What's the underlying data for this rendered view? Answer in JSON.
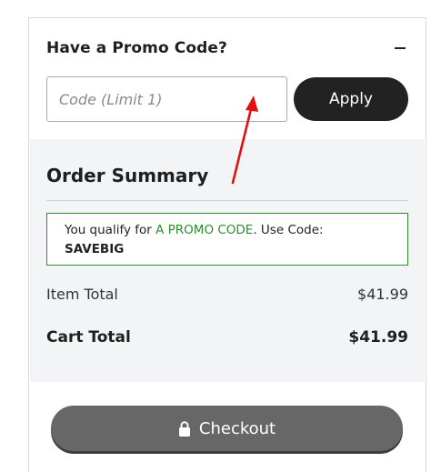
{
  "promo": {
    "title": "Have a Promo Code?",
    "collapse_label": "–",
    "input_placeholder": "Code (Limit 1)",
    "input_value": "",
    "apply_label": "Apply"
  },
  "summary": {
    "title": "Order Summary",
    "notice_prefix": "You qualify for ",
    "notice_highlight": "A PROMO CODE",
    "notice_suffix": ". Use Code:",
    "notice_code": "SAVEBIG",
    "item_total_label": "Item Total",
    "item_total_value": "$41.99",
    "cart_total_label": "Cart Total",
    "cart_total_value": "$41.99"
  },
  "checkout": {
    "label": "Checkout",
    "icon": "lock-icon"
  },
  "colors": {
    "apply_bg": "#222222",
    "checkout_bg": "#676767",
    "promo_green": "#2e8b2e",
    "summary_bg": "#f3f4f6",
    "annotation_arrow": "#e01010"
  }
}
